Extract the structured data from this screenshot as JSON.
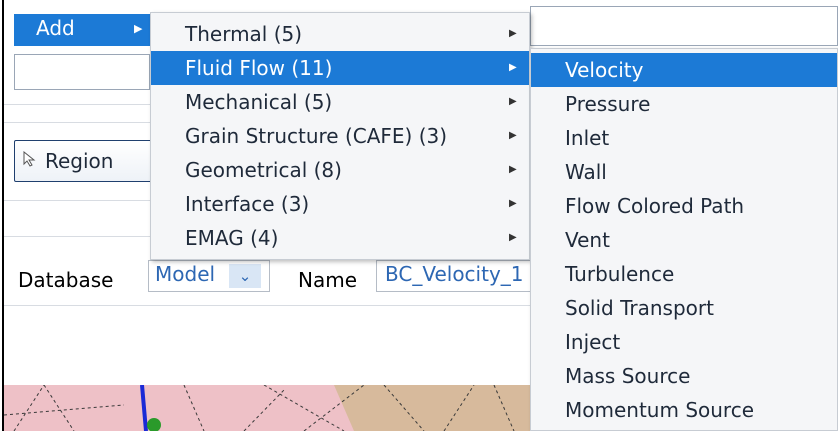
{
  "toolbar": {
    "add_label": "Add"
  },
  "region_button": {
    "label": "Region",
    "icon": "cursor-arrow-icon"
  },
  "form": {
    "database_label": "Database",
    "database_value": "Model",
    "name_label": "Name",
    "name_value": "BC_Velocity_1"
  },
  "menu_primary": {
    "items": [
      {
        "label": "Thermal (5)",
        "highlighted": false
      },
      {
        "label": "Fluid Flow (11)",
        "highlighted": true
      },
      {
        "label": "Mechanical (5)",
        "highlighted": false
      },
      {
        "label": "Grain Structure (CAFE) (3)",
        "highlighted": false
      },
      {
        "label": "Geometrical (8)",
        "highlighted": false
      },
      {
        "label": "Interface (3)",
        "highlighted": false
      },
      {
        "label": "EMAG (4)",
        "highlighted": false
      }
    ]
  },
  "menu_fluid_flow": {
    "items": [
      {
        "label": "Velocity",
        "highlighted": true
      },
      {
        "label": "Pressure",
        "highlighted": false
      },
      {
        "label": "Inlet",
        "highlighted": false
      },
      {
        "label": "Wall",
        "highlighted": false
      },
      {
        "label": "Flow Colored Path",
        "highlighted": false
      },
      {
        "label": "Vent",
        "highlighted": false
      },
      {
        "label": "Turbulence",
        "highlighted": false
      },
      {
        "label": "Solid Transport",
        "highlighted": false
      },
      {
        "label": "Inject",
        "highlighted": false
      },
      {
        "label": "Mass Source",
        "highlighted": false
      },
      {
        "label": "Momentum Source",
        "highlighted": false
      }
    ]
  },
  "colors": {
    "highlight": "#1c7ad6",
    "menu_bg": "#f5f6f8",
    "mesh_fill": "#eec1c7"
  }
}
